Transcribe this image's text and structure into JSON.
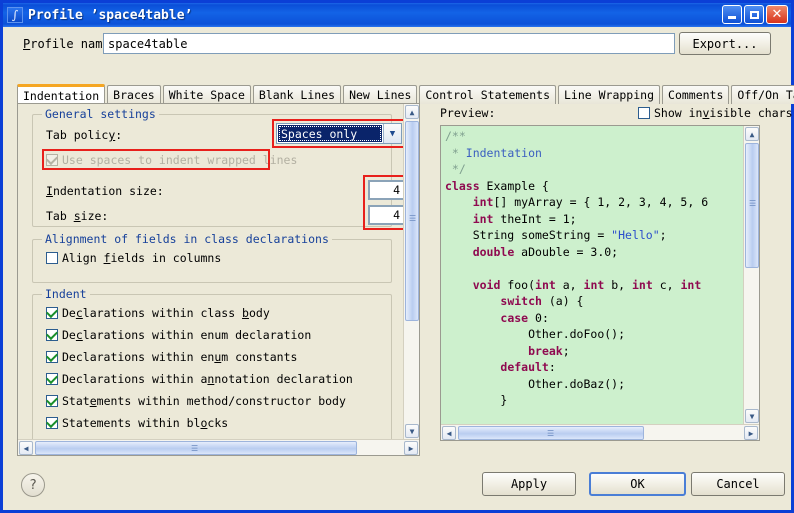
{
  "window": {
    "title": "Profile ’space4table’",
    "icon": "profile-icon",
    "minimize_label": "–",
    "maximize_label": "□",
    "close_label": "✕"
  },
  "profile": {
    "name_label": "Profile name:",
    "name_value": "space4table",
    "export_label": "Export..."
  },
  "tabs": [
    {
      "label": "Indentation",
      "active": true
    },
    {
      "label": "Braces",
      "active": false
    },
    {
      "label": "White Space",
      "active": false
    },
    {
      "label": "Blank Lines",
      "active": false
    },
    {
      "label": "New Lines",
      "active": false
    },
    {
      "label": "Control Statements",
      "active": false
    },
    {
      "label": "Line Wrapping",
      "active": false
    },
    {
      "label": "Comments",
      "active": false
    },
    {
      "label": "Off/On Tags",
      "active": false
    }
  ],
  "settings": {
    "general": {
      "title": "General settings",
      "tab_policy_label": "Tab policy:",
      "tab_policy_value": "Spaces only",
      "use_spaces_label": "Use spaces to indent wrapped lines",
      "use_spaces_checked": true,
      "use_spaces_enabled": false,
      "indentation_size_label": "Indentation size:",
      "indentation_size_value": "4",
      "tab_size_label": "Tab size:",
      "tab_size_value": "4"
    },
    "alignment": {
      "title": "Alignment of fields in class declarations",
      "align_fields_label": "Align fields in columns",
      "align_fields_checked": false
    },
    "indent": {
      "title": "Indent",
      "items": [
        {
          "label": "Declarations within class body",
          "checked": true
        },
        {
          "label": "Declarations within enum declaration",
          "checked": true
        },
        {
          "label": "Declarations within enum constants",
          "checked": true
        },
        {
          "label": "Declarations within annotation declaration",
          "checked": true
        },
        {
          "label": "Statements within method/constructor body",
          "checked": true
        },
        {
          "label": "Statements within blocks",
          "checked": true
        }
      ]
    }
  },
  "preview": {
    "label": "Preview:",
    "show_invisible_label": "Show invisible chars",
    "show_invisible_checked": false,
    "code_lines": [
      "/**",
      " * Indentation",
      " */",
      "class Example {",
      "    int[] myArray = { 1, 2, 3, 4, 5, 6",
      "    int theInt = 1;",
      "    String someString = \"Hello\";",
      "    double aDouble = 3.0;",
      "",
      "    void foo(int a, int b, int c, int",
      "        switch (a) {",
      "        case 0:",
      "            Other.doFoo();",
      "            break;",
      "        default:",
      "            Other.doBaz();",
      "        }"
    ]
  },
  "footer": {
    "help_label": "?",
    "apply_label": "Apply",
    "ok_label": "OK",
    "cancel_label": "Cancel"
  },
  "colors": {
    "title_bar": "#0b4fd8",
    "highlight_box": "#e8201b",
    "active_tab_accent": "#f5a623",
    "group_title": "#16409a",
    "code_background": "#cdf0cd",
    "combo_selection": "#0a246a"
  }
}
